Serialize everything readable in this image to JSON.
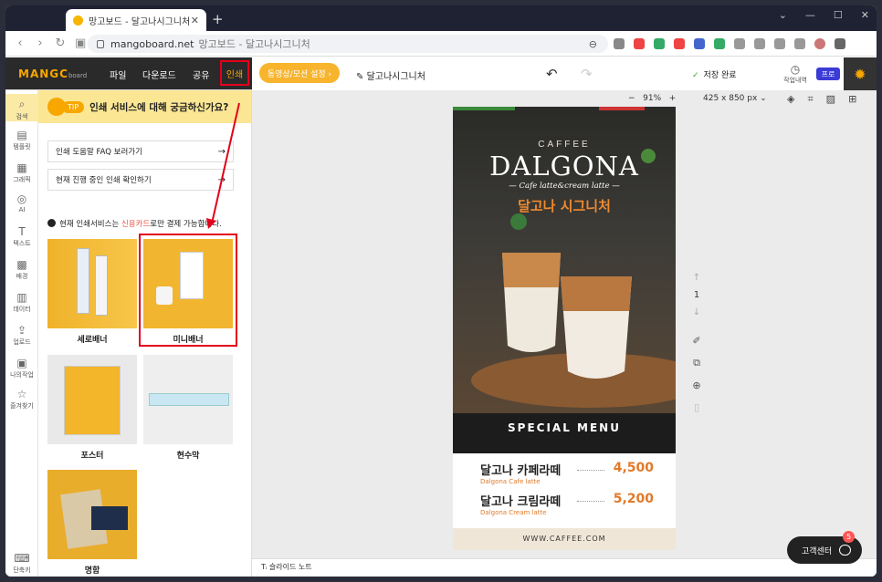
{
  "browser": {
    "tab_title": "망고보드 - 달고나시그니처",
    "tab_close": "✕",
    "new_tab": "+",
    "url_domain": "mangoboard.net",
    "url_title": "망고보드 - 달고나시그니처",
    "window_controls": [
      "⌄",
      "—",
      "☐",
      "✕"
    ]
  },
  "header": {
    "logo": "MANGC",
    "logo_sub": "board",
    "menu": [
      "파일",
      "다운로드",
      "공유"
    ],
    "print": "인쇄",
    "video_setting": "동영상/모션 설정 ›",
    "doc_title": "달고나시그니처",
    "save_status": "저장 완료",
    "history": "작업내역",
    "pro": "프로"
  },
  "rail": [
    {
      "icon": "⌕",
      "label": "검색"
    },
    {
      "icon": "▤",
      "label": "템플릿"
    },
    {
      "icon": "▦",
      "label": "그래픽"
    },
    {
      "icon": "◎",
      "label": "AI"
    },
    {
      "icon": "T",
      "label": "텍스트"
    },
    {
      "icon": "▩",
      "label": "배경"
    },
    {
      "icon": "▥",
      "label": "데이터"
    },
    {
      "icon": "⇪",
      "label": "업로드"
    },
    {
      "icon": "▣",
      "label": "나의작업"
    },
    {
      "icon": "☆",
      "label": "즐겨찾기"
    },
    {
      "icon": "⌨",
      "label": "단축키"
    }
  ],
  "panel": {
    "tip_badge": "TIP",
    "tip_text": "인쇄 서비스에 대해 궁금하신가요?",
    "faq_link": "인쇄 도움말 FAQ 보러가기",
    "progress_link": "현재 진행 중인 인쇄 확인하기",
    "arrow": "→",
    "notice_pre": "현재 인쇄서비스는 ",
    "notice_red": "신용카드",
    "notice_post": "로만 결제 가능합니다.",
    "items": [
      "세로배너",
      "미니배너",
      "포스터",
      "현수막",
      "명함"
    ]
  },
  "workspace": {
    "zoom_minus": "−",
    "zoom": "91%",
    "zoom_plus": "+",
    "dims": "425 x 850 px ⌄",
    "page_up": "↑",
    "page": "1",
    "page_down": "↓",
    "slide_note": "슬라이드 노트",
    "help": "고객센터",
    "help_badge": "5"
  },
  "design": {
    "brand": "CAFFEE",
    "title": "DALGONA",
    "subtitle": "— Cafe latte&cream latte —",
    "kor_title": "달고나 시그니처",
    "special": "SPECIAL MENU",
    "menu": [
      {
        "name": "달고나 카페라떼",
        "eng": "Dalgona Cafe latte",
        "price": "4,500"
      },
      {
        "name": "달고나 크림라떼",
        "eng": "Dalgona Cream latte",
        "price": "5,200"
      }
    ],
    "website": "WWW.CAFFEE.COM"
  },
  "colors": {
    "accent": "#f7a700",
    "highlight": "#e3001b",
    "tip": "#fbe694"
  }
}
